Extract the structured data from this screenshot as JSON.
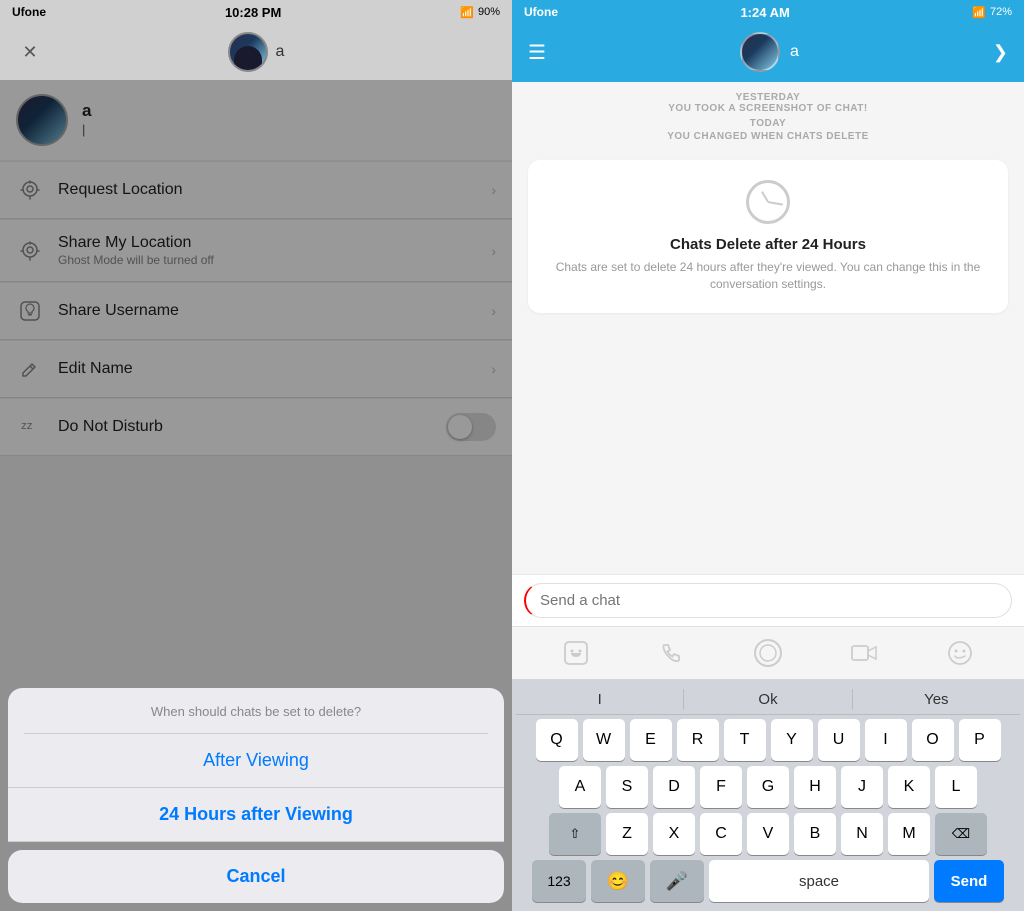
{
  "left": {
    "statusBar": {
      "carrier": "Ufone",
      "time": "10:28 PM",
      "battery": "90%"
    },
    "nav": {
      "closeIcon": "✕",
      "userName": "a"
    },
    "profile": {
      "name": "a"
    },
    "menuItems": [
      {
        "id": "request-location",
        "icon": "⊙",
        "title": "Request Location",
        "subtitle": "",
        "type": "chevron"
      },
      {
        "id": "share-location",
        "icon": "⊙",
        "title": "Share My Location",
        "subtitle": "Ghost Mode will be turned off",
        "type": "chevron"
      },
      {
        "id": "share-username",
        "icon": "👻",
        "title": "Share Username",
        "subtitle": "",
        "type": "chevron"
      },
      {
        "id": "edit-name",
        "icon": "✏",
        "title": "Edit Name",
        "subtitle": "",
        "type": "chevron"
      },
      {
        "id": "do-not-disturb",
        "icon": "💤",
        "title": "Do Not Disturb",
        "subtitle": "",
        "type": "toggle"
      }
    ],
    "actionSheet": {
      "question": "When should chats be set to delete?",
      "options": [
        {
          "id": "after-viewing",
          "label": "After Viewing"
        },
        {
          "id": "24-hours",
          "label": "24 Hours after Viewing"
        }
      ],
      "cancel": "Cancel"
    }
  },
  "right": {
    "statusBar": {
      "carrier": "Ufone",
      "time": "1:24 AM",
      "battery": "72%"
    },
    "nav": {
      "menuIcon": "☰",
      "userName": "a",
      "chevron": "❯"
    },
    "chat": {
      "yesterday": "YESTERDAY",
      "screenshotNotice": "YOU TOOK A SCREENSHOT OF CHAT!",
      "today": "TODAY",
      "changedNotice": "YOU CHANGED WHEN CHATS DELETE",
      "bubbleTitle": "Chats Delete after 24 Hours",
      "bubbleDesc": "Chats are set to delete 24 hours after they're viewed. You can change this in the conversation settings.",
      "inputPlaceholder": "Send a chat"
    },
    "keyboard": {
      "suggestions": [
        "I",
        "Ok",
        "Yes"
      ],
      "row1": [
        "Q",
        "W",
        "E",
        "R",
        "T",
        "Y",
        "U",
        "I",
        "O",
        "P"
      ],
      "row2": [
        "A",
        "S",
        "D",
        "F",
        "G",
        "H",
        "J",
        "K",
        "L"
      ],
      "row3": [
        "Z",
        "X",
        "C",
        "V",
        "B",
        "N",
        "M"
      ],
      "spaceLabel": "space",
      "sendLabel": "Send",
      "numLabel": "123",
      "deleteIcon": "⌫"
    }
  }
}
